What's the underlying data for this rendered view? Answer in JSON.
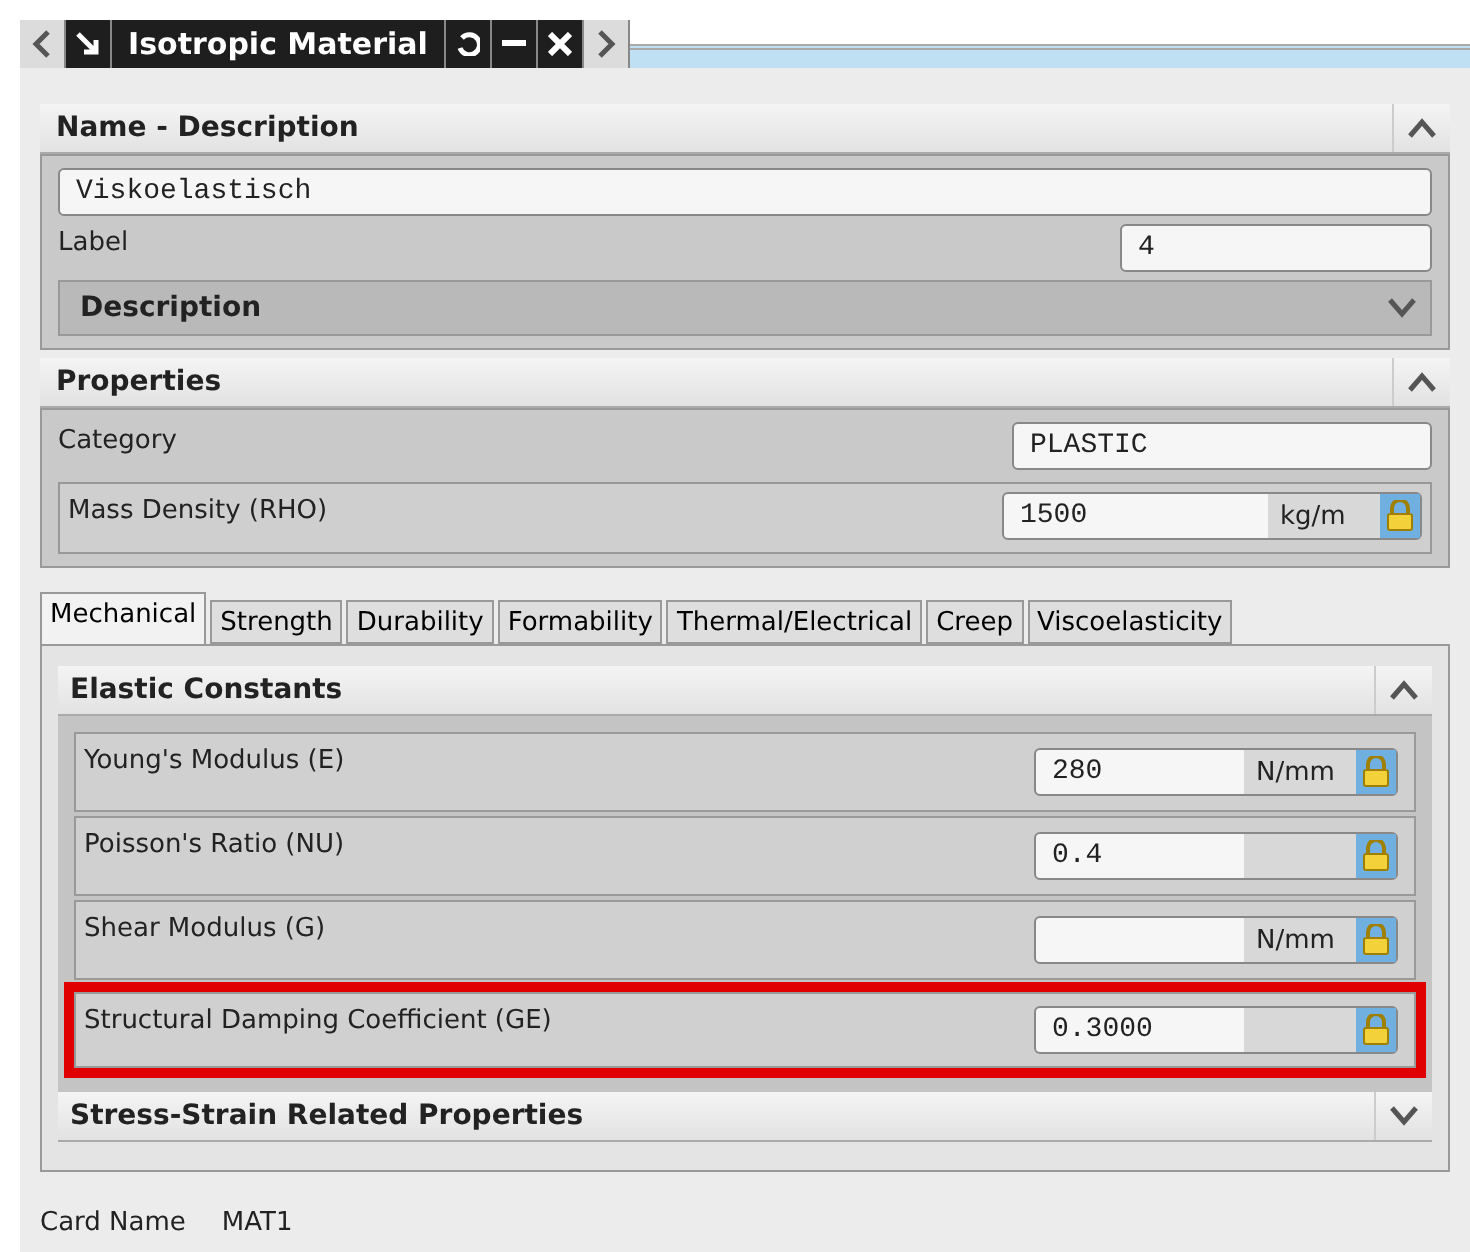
{
  "title_bar": {
    "title": "Isotropic Material"
  },
  "name_description": {
    "title": "Name - Description",
    "expanded": true,
    "name_value": "Viskoelastisch",
    "label": "Label",
    "label_value": "4",
    "description": {
      "title": "Description",
      "expanded": false
    }
  },
  "properties": {
    "title": "Properties",
    "expanded": true,
    "rows": [
      {
        "kind": "text",
        "label": "Category",
        "value": "PLASTIC"
      },
      {
        "kind": "quantity",
        "label": "Mass Density (RHO)",
        "value": "1500",
        "unit": "kg/m"
      }
    ]
  },
  "tabs": [
    {
      "label": "Mechanical",
      "selected": true
    },
    {
      "label": "Strength",
      "selected": false
    },
    {
      "label": "Durability",
      "selected": false
    },
    {
      "label": "Formability",
      "selected": false
    },
    {
      "label": "Thermal/Electrical",
      "selected": false
    },
    {
      "label": "Creep",
      "selected": false
    },
    {
      "label": "Viscoelasticity",
      "selected": false
    }
  ],
  "elastic_constants": {
    "title": "Elastic Constants",
    "expanded": true,
    "rows": [
      {
        "kind": "quantity",
        "label": "Young's Modulus (E)",
        "value": "280",
        "unit": "N/mm",
        "highlighted": false
      },
      {
        "kind": "quantity",
        "label": "Poisson's Ratio (NU)",
        "value": "0.4",
        "highlighted": false
      },
      {
        "kind": "quantity",
        "label": "Shear Modulus (G)",
        "unit": "N/mm",
        "highlighted": false
      },
      {
        "kind": "quantity",
        "label": "Structural Damping Coefficient (GE)",
        "value": "0.3000",
        "highlighted": true
      }
    ]
  },
  "stress_strain": {
    "title": "Stress-Strain Related Properties",
    "expanded": false
  },
  "footer": {
    "label": "Card Name",
    "value": "MAT1"
  }
}
